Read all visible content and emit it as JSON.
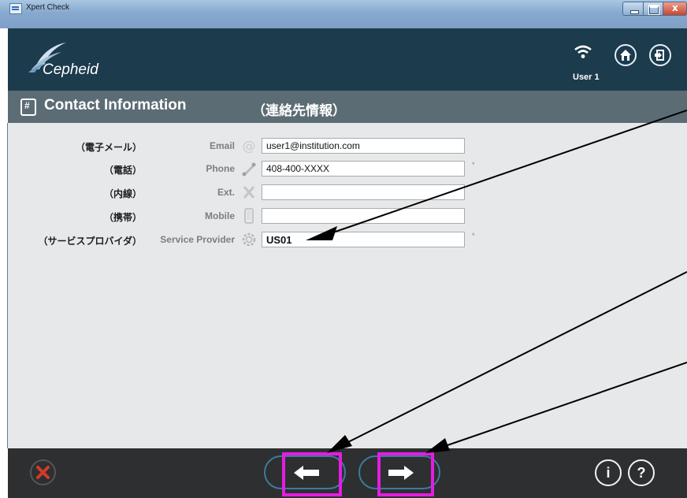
{
  "window": {
    "title": "Xpert Check"
  },
  "header": {
    "brand": "Cepheid",
    "user": "User 1"
  },
  "contact": {
    "title": "Contact Information",
    "title_jp": "（連絡先情報）"
  },
  "form": {
    "rows": [
      {
        "jp": "（電子メール）",
        "label": "Email",
        "icon": "at-icon",
        "value": "user1@institution.com",
        "required": false
      },
      {
        "jp": "（電話）",
        "label": "Phone",
        "icon": "phone-icon",
        "value": "408-400-XXXX",
        "required": true
      },
      {
        "jp": "（内線）",
        "label": "Ext.",
        "icon": "x-icon",
        "value": "",
        "required": false
      },
      {
        "jp": "（携帯）",
        "label": "Mobile",
        "icon": "mobile-icon",
        "value": "",
        "required": false
      },
      {
        "jp": "（サービスプロバイダ）",
        "label": "Service Provider",
        "icon": "gear-icon",
        "value": "US01",
        "required": true
      }
    ],
    "required_mark": "*"
  },
  "footer": {
    "info": "i",
    "help": "?"
  },
  "colors": {
    "header": "#1c3b4d",
    "band": "#5c6c75",
    "content": "#e6e8ea",
    "footer": "#2e2f30",
    "annotation": "#e21ee2"
  }
}
